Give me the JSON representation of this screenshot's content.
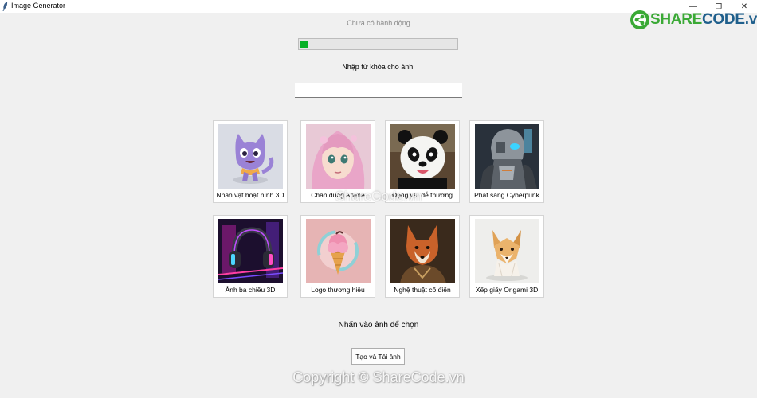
{
  "window": {
    "title": "Image Generator",
    "controls": [
      {
        "name": "minimize-icon",
        "glyph": "—"
      },
      {
        "name": "restore-icon",
        "glyph": "❐"
      },
      {
        "name": "close-icon",
        "glyph": "✕"
      }
    ]
  },
  "status": {
    "text": "Chưa có hành động",
    "progress_fraction": 0.05,
    "progress_color": "#06b025"
  },
  "prompt": {
    "label": "Nhập từ khóa cho ảnh:",
    "value": ""
  },
  "styles": [
    {
      "caption": "Nhân vật hoạt hình 3D",
      "icon": "cartoon-cat-icon"
    },
    {
      "caption": "Chân dung Anime",
      "icon": "anime-portrait-icon"
    },
    {
      "caption": "Động vật dễ thương",
      "icon": "panda-icon"
    },
    {
      "caption": "Phát sáng Cyberpunk",
      "icon": "cyberpunk-robot-icon"
    },
    {
      "caption": "Ảnh ba chiều 3D",
      "icon": "headphones-icon"
    },
    {
      "caption": "Logo thương hiệu",
      "icon": "ice-cream-logo-icon"
    },
    {
      "caption": "Nghệ thuật cổ điển",
      "icon": "fox-portrait-icon"
    },
    {
      "caption": "Xếp giấy Origami 3D",
      "icon": "origami-dog-icon"
    }
  ],
  "hint": "Nhấn vào ảnh để chọn",
  "generate_button": "Tạo và Tải ảnh",
  "overlays": {
    "logo_share": "SHARE",
    "logo_code": "CODE.vn",
    "logo_color_green": "#3aa935",
    "logo_color_dark": "#1f5f8c",
    "watermark": "ShareCode.vn",
    "copyright": "Copyright © ShareCode.vn"
  }
}
